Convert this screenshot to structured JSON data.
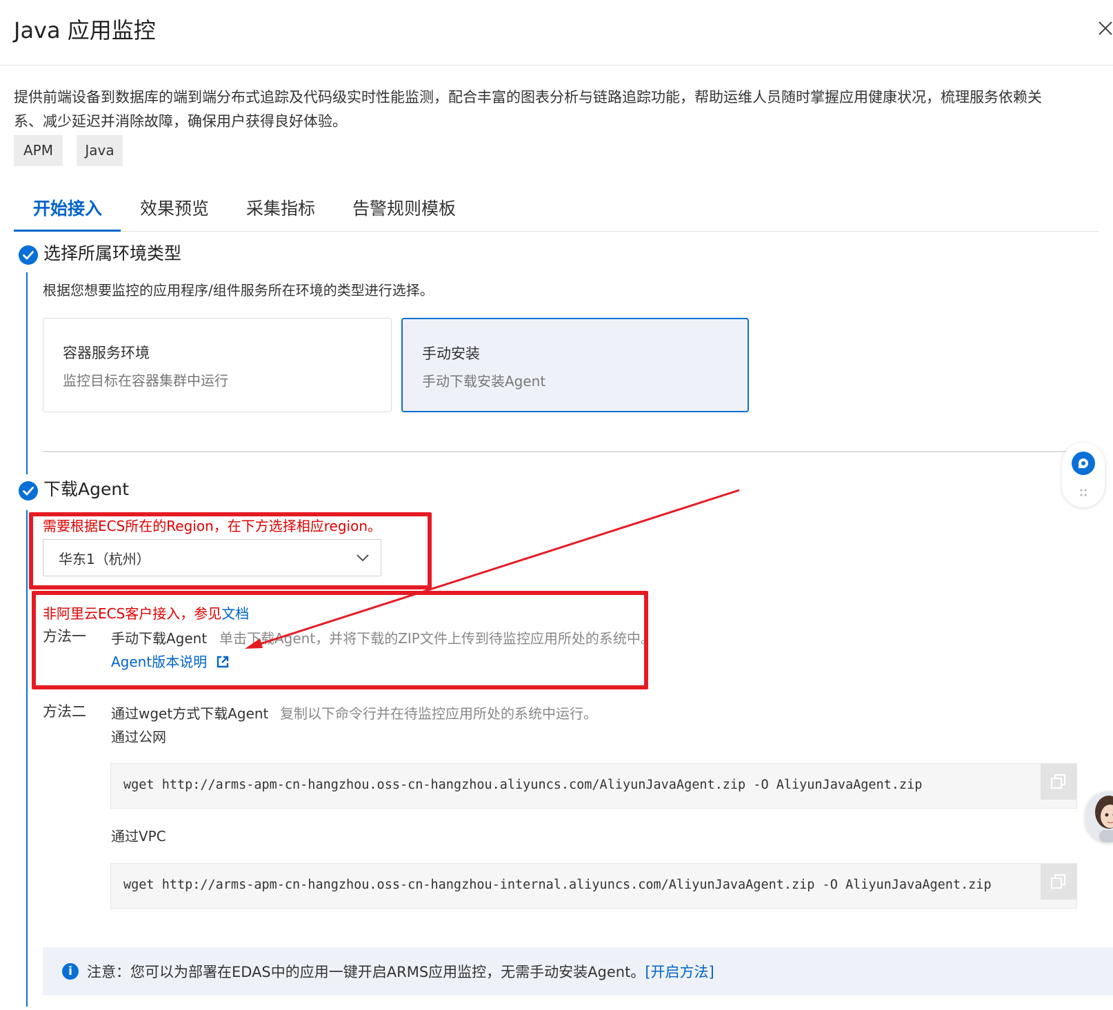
{
  "dialog": {
    "title": "Java 应用监控",
    "description": "提供前端设备到数据库的端到端分布式追踪及代码级实时性能监测，配合丰富的图表分析与链路追踪功能，帮助运维人员随时掌握应用健康状况，梳理服务依赖关系、减少延迟并消除故障，确保用户获得良好体验。",
    "tags": [
      "APM",
      "Java"
    ]
  },
  "tabs": [
    {
      "label": "开始接入",
      "active": true
    },
    {
      "label": "效果预览",
      "active": false
    },
    {
      "label": "采集指标",
      "active": false
    },
    {
      "label": "告警规则模板",
      "active": false
    }
  ],
  "step1": {
    "title": "选择所属环境类型",
    "hint": "根据您想要监控的应用程序/组件服务所在环境的类型进行选择。",
    "cards": [
      {
        "title": "容器服务环境",
        "subtitle": "监控目标在容器集群中运行",
        "selected": false
      },
      {
        "title": "手动安装",
        "subtitle": "手动下载安装Agent",
        "selected": true
      }
    ]
  },
  "step2": {
    "title": "下载Agent",
    "region_note": "需要根据ECS所在的Region，在下方选择相应region。",
    "region_value": "华东1（杭州）",
    "non_ecs_prefix": "非阿里云ECS客户接入，参见",
    "non_ecs_link": "文档",
    "method1": {
      "label": "方法一",
      "title": "手动下载Agent",
      "desc": "单击下载Agent，并将下载的ZIP文件上传到待监控应用所处的系统中。",
      "link": "Agent版本说明"
    },
    "method2": {
      "label": "方法二",
      "title": "通过wget方式下载Agent",
      "desc": "复制以下命令行并在待监控应用所处的系统中运行。",
      "public_label": "通过公网",
      "public_cmd": "wget http://arms-apm-cn-hangzhou.oss-cn-hangzhou.aliyuncs.com/AliyunJavaAgent.zip -O AliyunJavaAgent.zip",
      "vpc_label": "通过VPC",
      "vpc_cmd": "wget http://arms-apm-cn-hangzhou.oss-cn-hangzhou-internal.aliyuncs.com/AliyunJavaAgent.zip -O AliyunJavaAgent.zip"
    },
    "notice_text": "注意：您可以为部署在EDAS中的应用一键开启ARMS应用监控，无需手动安装Agent。",
    "notice_link": "[开启方法]"
  },
  "icons": {
    "close": "close-icon",
    "step_done": "check-circle-icon",
    "select_caret": "chevron-down-icon",
    "external_link": "external-link-icon",
    "copy": "copy-icon",
    "info": "info-icon",
    "chat": "chat-bubble-icon",
    "drag": "drag-handle-icon",
    "assistant": "avatar"
  },
  "colors": {
    "accent": "#0064c8",
    "annotation_red": "#e51b24",
    "selected_card_bg": "#eef2f8"
  }
}
